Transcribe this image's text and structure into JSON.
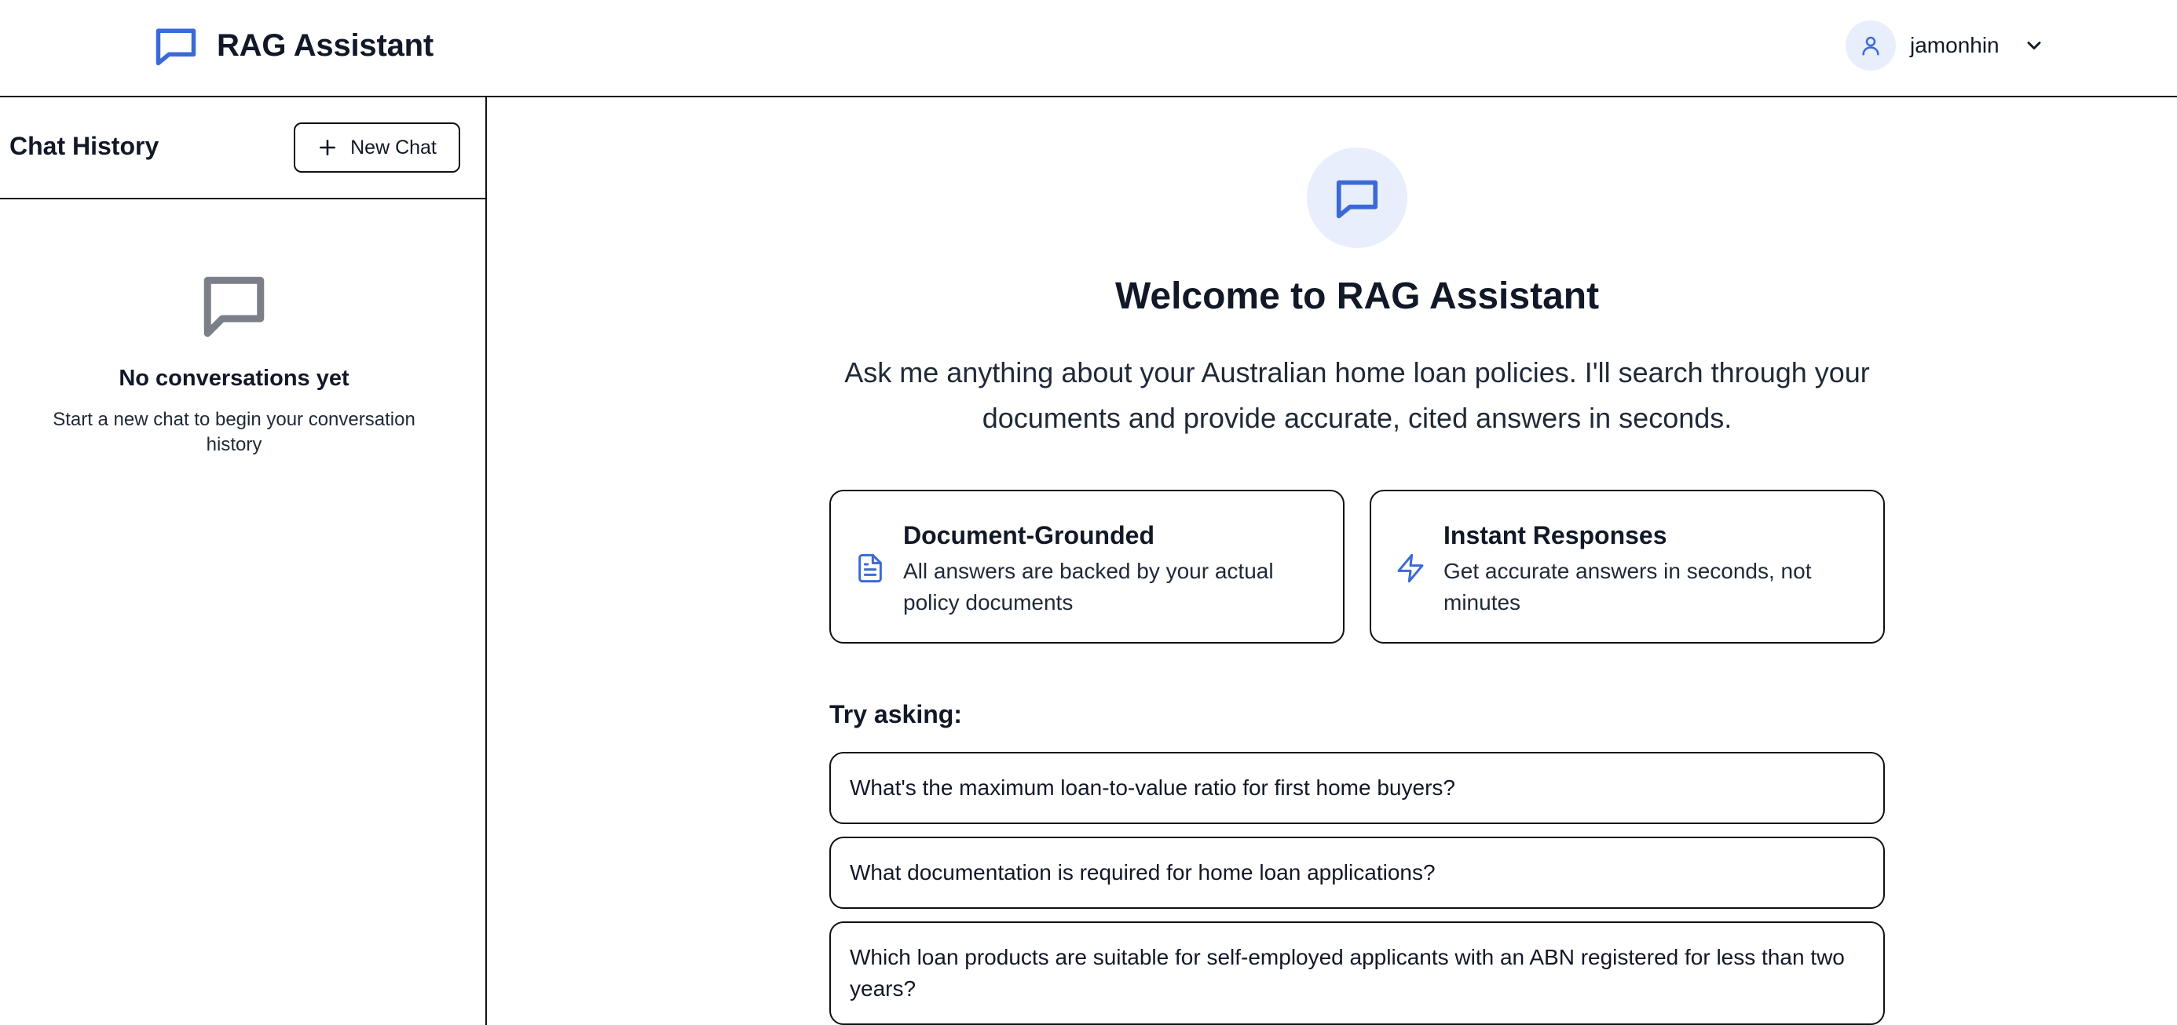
{
  "header": {
    "app_title": "RAG Assistant",
    "brand_icon": "chat-bubble-icon",
    "username": "jamonhin",
    "accent_color": "#3b6ad6"
  },
  "sidebar": {
    "title": "Chat History",
    "new_chat_label": "New Chat",
    "empty_title": "No conversations yet",
    "empty_subtitle": "Start a new chat to begin your conversation history"
  },
  "main": {
    "welcome_title": "Welcome to RAG Assistant",
    "intro": "Ask me anything about your Australian home loan policies. I'll search through your documents and provide accurate, cited answers in seconds.",
    "features": [
      {
        "icon": "document-icon",
        "title": "Document-Grounded",
        "description": "All answers are backed by your actual policy documents"
      },
      {
        "icon": "lightning-icon",
        "title": "Instant Responses",
        "description": "Get accurate answers in seconds, not minutes"
      }
    ],
    "try_label": "Try asking:",
    "suggestions": [
      "What's the maximum loan-to-value ratio for first home buyers?",
      "What documentation is required for home loan applications?",
      "Which loan products are suitable for self-employed applicants with an ABN registered for less than two years?"
    ]
  }
}
